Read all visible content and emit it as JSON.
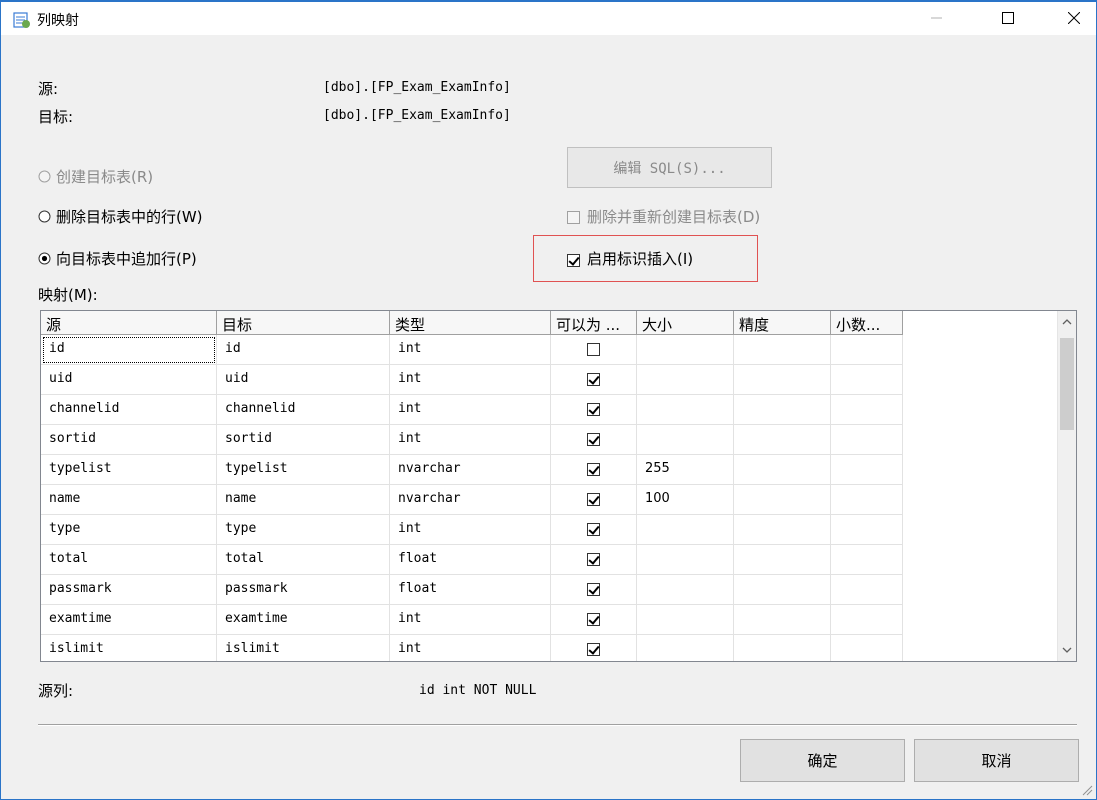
{
  "window": {
    "title": "列映射"
  },
  "source": {
    "label": "源:",
    "value": "[dbo].[FP_Exam_ExamInfo]"
  },
  "target": {
    "label": "目标:",
    "value": "[dbo].[FP_Exam_ExamInfo]"
  },
  "options": {
    "create_target_table": "创建目标表(R)",
    "delete_rows": "删除目标表中的行(W)",
    "append_rows": "向目标表中追加行(P)",
    "edit_sql": "编辑 SQL(S)...",
    "drop_recreate": "删除并重新创建目标表(D)",
    "enable_identity_insert": "启用标识插入(I)"
  },
  "mapping": {
    "label": "映射(M):",
    "columns": [
      "源",
      "目标",
      "类型",
      "可以为 ...",
      "大小",
      "精度",
      "小数..."
    ],
    "rows": [
      {
        "source": "id",
        "target": "id",
        "type": "int",
        "nullable": false,
        "size": "",
        "precision": "",
        "scale": ""
      },
      {
        "source": "uid",
        "target": "uid",
        "type": "int",
        "nullable": true,
        "size": "",
        "precision": "",
        "scale": ""
      },
      {
        "source": "channelid",
        "target": "channelid",
        "type": "int",
        "nullable": true,
        "size": "",
        "precision": "",
        "scale": ""
      },
      {
        "source": "sortid",
        "target": "sortid",
        "type": "int",
        "nullable": true,
        "size": "",
        "precision": "",
        "scale": ""
      },
      {
        "source": "typelist",
        "target": "typelist",
        "type": "nvarchar",
        "nullable": true,
        "size": "255",
        "precision": "",
        "scale": ""
      },
      {
        "source": "name",
        "target": "name",
        "type": "nvarchar",
        "nullable": true,
        "size": "100",
        "precision": "",
        "scale": ""
      },
      {
        "source": "type",
        "target": "type",
        "type": "int",
        "nullable": true,
        "size": "",
        "precision": "",
        "scale": ""
      },
      {
        "source": "total",
        "target": "total",
        "type": "float",
        "nullable": true,
        "size": "",
        "precision": "",
        "scale": ""
      },
      {
        "source": "passmark",
        "target": "passmark",
        "type": "float",
        "nullable": true,
        "size": "",
        "precision": "",
        "scale": ""
      },
      {
        "source": "examtime",
        "target": "examtime",
        "type": "int",
        "nullable": true,
        "size": "",
        "precision": "",
        "scale": ""
      },
      {
        "source": "islimit",
        "target": "islimit",
        "type": "int",
        "nullable": true,
        "size": "",
        "precision": "",
        "scale": ""
      }
    ]
  },
  "source_column": {
    "label": "源列:",
    "value": "id int NOT NULL"
  },
  "buttons": {
    "ok": "确定",
    "cancel": "取消"
  },
  "colors": {
    "highlight_border": "#e05252",
    "window_border": "#2a74c8"
  }
}
